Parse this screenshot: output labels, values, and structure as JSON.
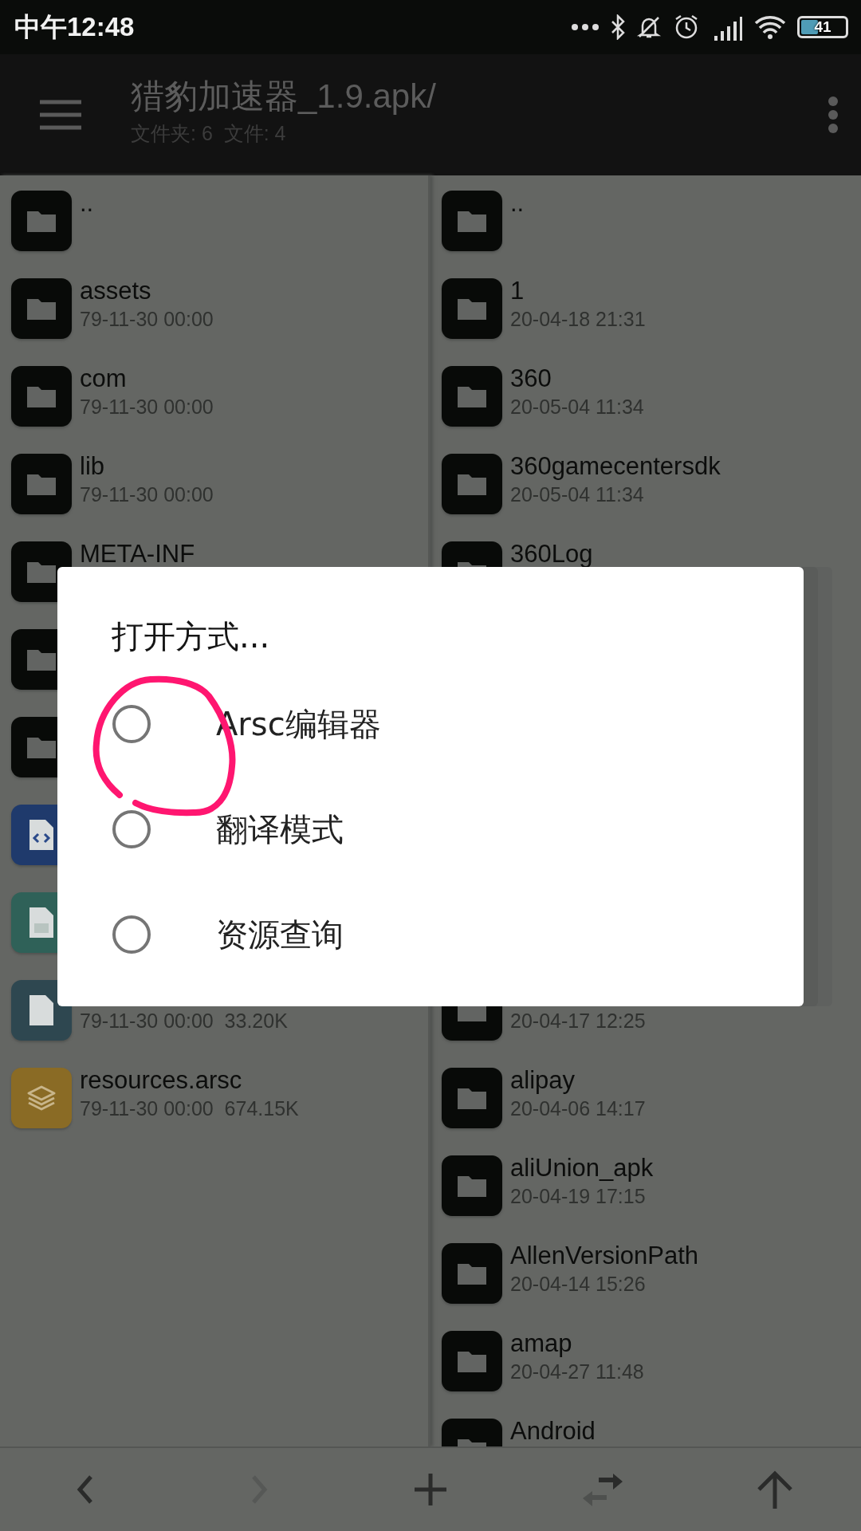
{
  "status_bar": {
    "time": "中午12:48",
    "battery": "41"
  },
  "toolbar": {
    "title": "猎豹加速器_1.9.apk/",
    "subtitle": "文件夹: 6  文件: 4"
  },
  "left_pane": {
    "rows": [
      {
        "kind": "folder",
        "name": ".."
      },
      {
        "kind": "folder",
        "name": "assets",
        "meta": "79-11-30 00:00"
      },
      {
        "kind": "folder",
        "name": "com",
        "meta": "79-11-30 00:00"
      },
      {
        "kind": "folder",
        "name": "lib",
        "meta": "79-11-30 00:00"
      },
      {
        "kind": "folder",
        "name": "META-INF"
      },
      {
        "kind": "folder"
      },
      {
        "kind": "folder"
      },
      {
        "kind": "code"
      },
      {
        "kind": "binary"
      },
      {
        "kind": "file",
        "meta": "79-11-30 00:00  33.20K"
      },
      {
        "kind": "arsc",
        "name": "resources.arsc",
        "meta": "79-11-30 00:00  674.15K"
      }
    ]
  },
  "right_pane": {
    "rows": [
      {
        "kind": "folder",
        "name": ".."
      },
      {
        "kind": "folder",
        "name": "1",
        "meta": "20-04-18 21:31"
      },
      {
        "kind": "folder",
        "name": "360",
        "meta": "20-05-04 11:34"
      },
      {
        "kind": "folder",
        "name": "360gamecentersdk",
        "meta": "20-05-04 11:34"
      },
      {
        "kind": "folder",
        "name": "360Log"
      },
      {
        "kind": "folder",
        "meta": "20-04-17 12:25"
      },
      {
        "kind": "folder",
        "name": "alipay",
        "meta": "20-04-06 14:17"
      },
      {
        "kind": "folder",
        "name": "aliUnion_apk",
        "meta": "20-04-19 17:15"
      },
      {
        "kind": "folder",
        "name": "AllenVersionPath",
        "meta": "20-04-14 15:26"
      },
      {
        "kind": "folder",
        "name": "amap",
        "meta": "20-04-27 11:48"
      },
      {
        "kind": "folder",
        "name": "Android"
      }
    ]
  },
  "bottom_bar": [
    {
      "kind": "back",
      "disabled": false
    },
    {
      "kind": "forward",
      "disabled": true
    },
    {
      "kind": "add",
      "disabled": false
    },
    {
      "kind": "swap",
      "disabled": false
    },
    {
      "kind": "up",
      "disabled": false
    }
  ],
  "dialog": {
    "title": "打开方式...",
    "options": [
      {
        "label": "Arsc编辑器",
        "selected": false
      },
      {
        "label": "翻译模式",
        "selected": false
      },
      {
        "label": "资源查询",
        "selected": false
      }
    ]
  }
}
